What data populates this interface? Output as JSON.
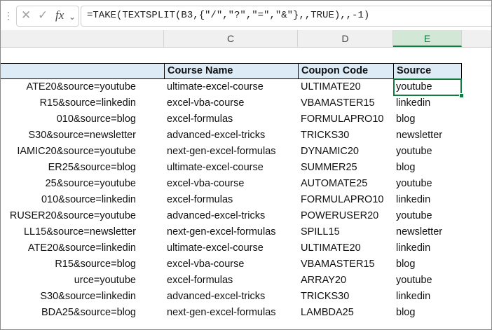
{
  "formula_bar": {
    "cancel_icon": "x-icon",
    "enter_icon": "check-icon",
    "fx_label": "fx",
    "formula": "=TAKE(TEXTSPLIT(B3,{\"/\",\"?\",\"=\",\"&\"},,TRUE),,-1)"
  },
  "columns": [
    "C",
    "D",
    "E"
  ],
  "selected_column": "E",
  "table": {
    "headers": [
      "",
      "Course Name",
      "Coupon Code",
      "Source"
    ],
    "rows": [
      [
        "ATE20&source=youtube",
        "ultimate-excel-course",
        "ULTIMATE20",
        "youtube"
      ],
      [
        "R15&source=linkedin",
        "excel-vba-course",
        "VBAMASTER15",
        "linkedin"
      ],
      [
        "010&source=blog",
        "excel-formulas",
        "FORMULAPRO10",
        "blog"
      ],
      [
        "S30&source=newsletter",
        "advanced-excel-tricks",
        "TRICKS30",
        "newsletter"
      ],
      [
        "IAMIC20&source=youtube",
        "next-gen-excel-formulas",
        "DYNAMIC20",
        "youtube"
      ],
      [
        "ER25&source=blog",
        "ultimate-excel-course",
        "SUMMER25",
        "blog"
      ],
      [
        "25&source=youtube",
        "excel-vba-course",
        "AUTOMATE25",
        "youtube"
      ],
      [
        "010&source=linkedin",
        "excel-formulas",
        "FORMULAPRO10",
        "linkedin"
      ],
      [
        "RUSER20&source=youtube",
        "advanced-excel-tricks",
        "POWERUSER20",
        "youtube"
      ],
      [
        "LL15&source=newsletter",
        "next-gen-excel-formulas",
        "SPILL15",
        "newsletter"
      ],
      [
        "ATE20&source=linkedin",
        "ultimate-excel-course",
        "ULTIMATE20",
        "linkedin"
      ],
      [
        "R15&source=blog",
        "excel-vba-course",
        "VBAMASTER15",
        "blog"
      ],
      [
        "urce=youtube",
        "excel-formulas",
        "ARRAY20",
        "youtube"
      ],
      [
        "S30&source=linkedin",
        "advanced-excel-tricks",
        "TRICKS30",
        "linkedin"
      ],
      [
        "BDA25&source=blog",
        "next-gen-excel-formulas",
        "LAMBDA25",
        "blog"
      ]
    ]
  }
}
